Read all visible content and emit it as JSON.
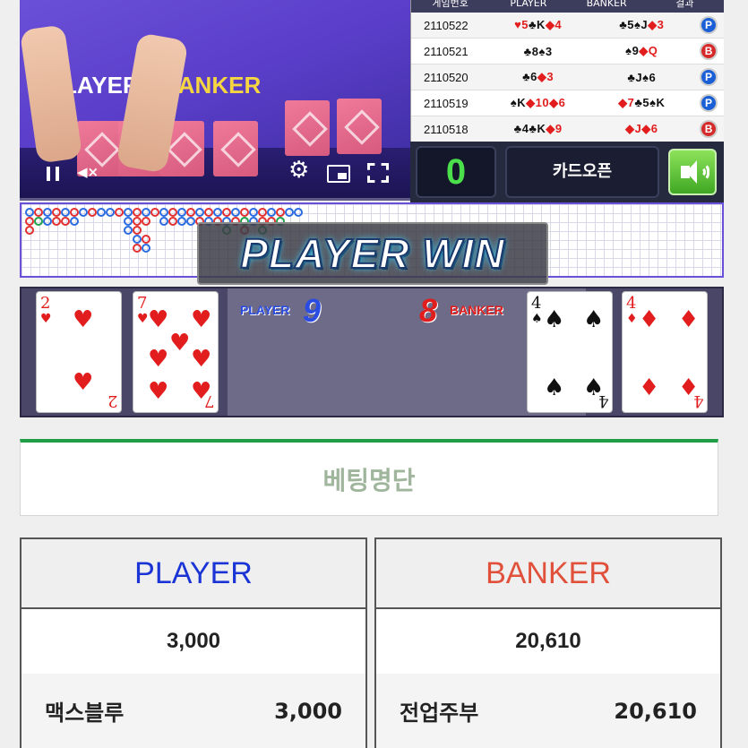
{
  "video": {
    "banner_player": "LAYER",
    "banner_banker": "BANKER",
    "mute_label": "◀×"
  },
  "history": {
    "headers": [
      "게임번호",
      "PLAYER",
      "BANKER",
      "결과"
    ],
    "rows": [
      {
        "num": "2110522",
        "player": [
          [
            "♥5",
            "red"
          ],
          [
            "♣K",
            "blk"
          ],
          [
            "◆4",
            "red"
          ]
        ],
        "banker": [
          [
            "♣5",
            "blk"
          ],
          [
            "♠J",
            "blk"
          ],
          [
            "◆3",
            "red"
          ]
        ],
        "result": "P"
      },
      {
        "num": "2110521",
        "player": [
          [
            "♣8",
            "blk"
          ],
          [
            "♠3",
            "blk"
          ]
        ],
        "banker": [
          [
            "♠9",
            "blk"
          ],
          [
            "◆Q",
            "red"
          ]
        ],
        "result": "B"
      },
      {
        "num": "2110520",
        "player": [
          [
            "♣6",
            "blk"
          ],
          [
            "◆3",
            "red"
          ]
        ],
        "banker": [
          [
            "♣J",
            "blk"
          ],
          [
            "♠6",
            "blk"
          ]
        ],
        "result": "P"
      },
      {
        "num": "2110519",
        "player": [
          [
            "♠K",
            "blk"
          ],
          [
            "◆10",
            "red"
          ],
          [
            "◆6",
            "red"
          ]
        ],
        "banker": [
          [
            "◆7",
            "red"
          ],
          [
            "♣5",
            "blk"
          ],
          [
            "♠K",
            "blk"
          ]
        ],
        "result": "P"
      },
      {
        "num": "2110518",
        "player": [
          [
            "♣4",
            "blk"
          ],
          [
            "♣K",
            "blk"
          ],
          [
            "◆9",
            "red"
          ]
        ],
        "banker": [
          [
            "◆J",
            "red"
          ],
          [
            "◆6",
            "red"
          ]
        ],
        "result": "B"
      }
    ]
  },
  "controls": {
    "timer": "0",
    "open_cards": "카드오픈"
  },
  "result_banner": "PLAYER WIN",
  "table": {
    "player_label": "PLAYER",
    "player_score": "9",
    "banker_label": "BANKER",
    "banker_score": "8",
    "player_cards": [
      {
        "rank": "2",
        "suit": "♥",
        "color": "red"
      },
      {
        "rank": "7",
        "suit": "♥",
        "color": "red"
      }
    ],
    "banker_cards": [
      {
        "rank": "4",
        "suit": "♠",
        "color": "blk"
      },
      {
        "rank": "4",
        "suit": "♦",
        "color": "red"
      }
    ]
  },
  "betting": {
    "title": "베팅명단",
    "player": {
      "title": "PLAYER",
      "total": "3,000",
      "entry_name": "맥스블루",
      "entry_amount": "3,000"
    },
    "banker": {
      "title": "BANKER",
      "total": "20,610",
      "entry_name": "전업주부",
      "entry_amount": "20,610"
    }
  },
  "colors": {
    "player": "#1b34d6",
    "banker": "#e0503a",
    "timer": "#4be04b",
    "accent_green": "#1f9e47"
  }
}
